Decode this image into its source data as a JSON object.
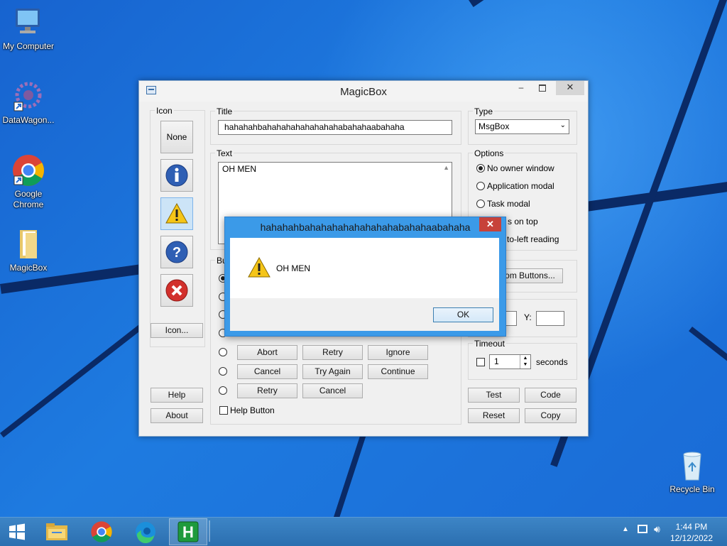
{
  "desktop": {
    "icons": [
      {
        "label": "My Computer",
        "icon": "computer-icon"
      },
      {
        "label": "DataWagon...",
        "icon": "datawagon-icon"
      },
      {
        "label": "Google Chrome",
        "icon": "chrome-icon"
      },
      {
        "label": "MagicBox",
        "icon": "folder-icon"
      },
      {
        "label": "Recycle Bin",
        "icon": "recycle-bin-icon"
      }
    ]
  },
  "main_window": {
    "title": "MagicBox",
    "icon_group": {
      "label": "Icon",
      "none_label": "None",
      "icon_button_label": "Icon...",
      "selected": "warning"
    },
    "title_group": {
      "label": "Title",
      "value": "hahahahbahahahahahahahahabahahaabahaha"
    },
    "text_group": {
      "label": "Text",
      "value": "OH MEN"
    },
    "buttons_group": {
      "label": "Bu",
      "rows": [
        [
          "Abort",
          "Retry",
          "Ignore"
        ],
        [
          "Cancel",
          "Try Again",
          "Continue"
        ],
        [
          "Retry",
          "Cancel"
        ]
      ],
      "help_button_label": "Help Button"
    },
    "type_group": {
      "label": "Type",
      "selected": "MsgBox"
    },
    "options_group": {
      "label": "Options",
      "items": [
        {
          "label": "No owner window",
          "selected": true
        },
        {
          "label": "Application modal",
          "selected": false
        },
        {
          "label": "Task modal",
          "selected": false
        },
        {
          "label": "s on top",
          "selected": false
        },
        {
          "label": "to-left reading",
          "selected": false
        }
      ]
    },
    "custom_buttons_label": "om Buttons...",
    "position": {
      "y_label": "Y:"
    },
    "timeout": {
      "label": "Timeout",
      "value": "1",
      "unit": "seconds"
    },
    "bottom_buttons": {
      "help": "Help",
      "about": "About",
      "test": "Test",
      "code": "Code",
      "reset": "Reset",
      "copy": "Copy"
    }
  },
  "message_box": {
    "title": "hahahahbahahahahahahahahabahahaabahaha",
    "text": "OH MEN",
    "ok_label": "OK",
    "close_symbol": "✕"
  },
  "taskbar": {
    "apps": [
      "windows-start-icon",
      "file-explorer-icon",
      "chrome-icon",
      "edge-icon",
      "h-app-icon"
    ],
    "time": "1:44 PM",
    "date": "12/12/2022"
  }
}
